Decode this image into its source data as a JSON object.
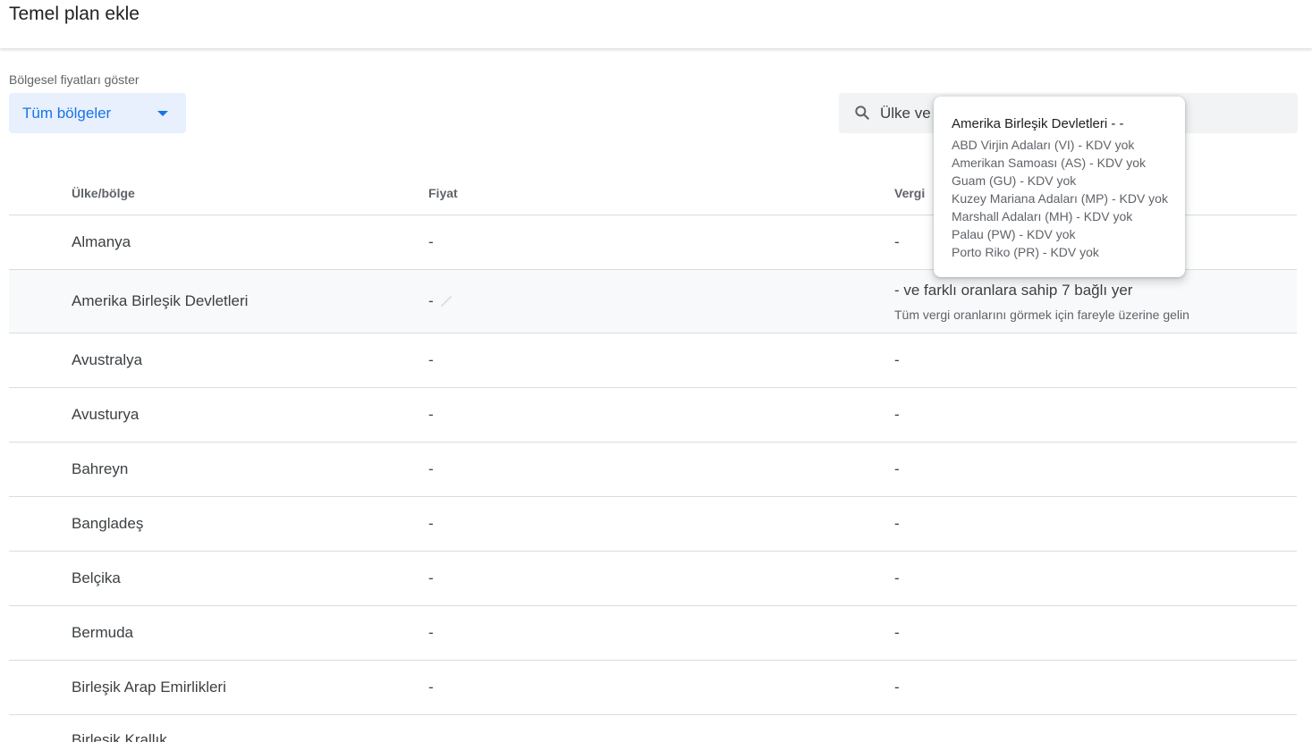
{
  "header": {
    "title": "Temel plan ekle"
  },
  "filters": {
    "region_label": "Bölgesel fiyatları göster",
    "region_value": "Tüm bölgeler",
    "search_placeholder": "Ülke ve"
  },
  "table": {
    "columns": [
      "Ülke/bölge",
      "Fiyat",
      "Vergi"
    ],
    "rows": [
      {
        "country": "Almanya",
        "price": "-",
        "tax": "-"
      },
      {
        "country": "Amerika Birleşik Devletleri",
        "price": "-",
        "tax": "- ve farklı oranlara sahip 7 bağlı yer",
        "tax_hint": "Tüm vergi oranlarını görmek için fareyle üzerine gelin"
      },
      {
        "country": "Avustralya",
        "price": "-",
        "tax": "-"
      },
      {
        "country": "Avusturya",
        "price": "-",
        "tax": "-"
      },
      {
        "country": "Bahreyn",
        "price": "-",
        "tax": "-"
      },
      {
        "country": "Bangladeş",
        "price": "-",
        "tax": "-"
      },
      {
        "country": "Belçika",
        "price": "-",
        "tax": "-"
      },
      {
        "country": "Bermuda",
        "price": "-",
        "tax": "-"
      },
      {
        "country": "Birleşik Arap Emirlikleri",
        "price": "-",
        "tax": "-"
      },
      {
        "country": "Birleşik Krallık",
        "price": "",
        "tax": ""
      }
    ]
  },
  "tooltip": {
    "title": "Amerika Birleşik Devletleri - -",
    "items": [
      "ABD Virjin Adaları (VI) - KDV yok",
      "Amerikan Samoası (AS) - KDV yok",
      "Guam (GU) - KDV yok",
      "Kuzey Mariana Adaları (MP) - KDV yok",
      "Marshall Adaları (MH) - KDV yok",
      "Palau (PW) - KDV yok",
      "Porto Riko (PR) - KDV yok"
    ]
  },
  "icons": {
    "search": "search-icon",
    "dropdown": "caret-down-icon",
    "edit": "pencil-icon"
  },
  "colors": {
    "accent": "#1a73e8",
    "select_bg": "#e8f0fe",
    "search_bg": "#f1f3f4"
  }
}
